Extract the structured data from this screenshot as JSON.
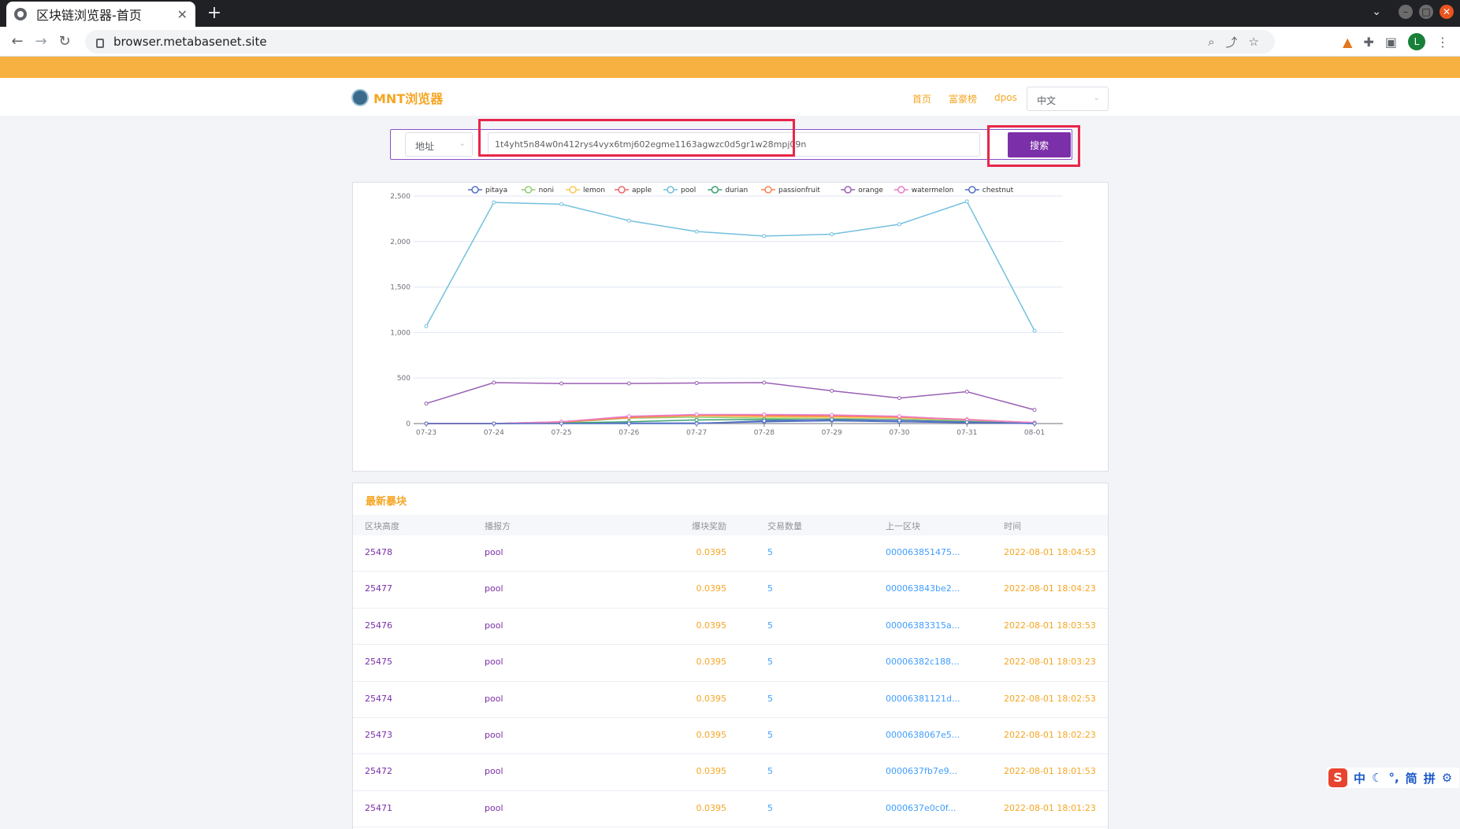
{
  "browser": {
    "tab_title": "区块链浏览器-首页",
    "tab_close": "✕",
    "new_tab": "+",
    "url": "browser.metabasenet.site",
    "avatar_letter": "L"
  },
  "site": {
    "logo_text": "MNT浏览器",
    "nav": [
      "首页",
      "富豪榜",
      "dpos"
    ],
    "lang": "中文"
  },
  "search": {
    "type_label": "地址",
    "input_value": "1t4yht5n84w0n412rys4vyx6tmj602egme1163agwzc0d5gr1w28mpj09n",
    "button_label": "搜索"
  },
  "chart_data": {
    "type": "line",
    "categories": [
      "07-23",
      "07-24",
      "07-25",
      "07-26",
      "07-27",
      "07-28",
      "07-29",
      "07-30",
      "07-31",
      "08-01"
    ],
    "ylim": [
      0,
      2500
    ],
    "yticks": [
      "0",
      "500",
      "1,000",
      "1,500",
      "2,000",
      "2,500"
    ],
    "ytick_values": [
      0,
      500,
      1000,
      1500,
      2000,
      2500
    ],
    "legend_position": "top-center",
    "grid": true,
    "series": [
      {
        "name": "pitaya",
        "color": "#5470c6",
        "values": [
          0,
          0,
          5,
          5,
          5,
          20,
          30,
          20,
          10,
          0
        ]
      },
      {
        "name": "noni",
        "color": "#91cc75",
        "values": [
          0,
          0,
          10,
          60,
          70,
          60,
          55,
          50,
          30,
          5
        ]
      },
      {
        "name": "lemon",
        "color": "#fac858",
        "values": [
          0,
          0,
          15,
          70,
          85,
          75,
          70,
          65,
          40,
          5
        ]
      },
      {
        "name": "apple",
        "color": "#ee6666",
        "values": [
          0,
          0,
          20,
          75,
          95,
          90,
          85,
          75,
          45,
          10
        ]
      },
      {
        "name": "pool",
        "color": "#73c0de",
        "values": [
          1070,
          2430,
          2410,
          2230,
          2110,
          2060,
          2080,
          2190,
          2440,
          1020
        ]
      },
      {
        "name": "durian",
        "color": "#3ba272",
        "values": [
          0,
          0,
          5,
          20,
          40,
          45,
          40,
          35,
          20,
          5
        ]
      },
      {
        "name": "passionfruit",
        "color": "#fc8452",
        "values": [
          0,
          0,
          15,
          65,
          90,
          85,
          80,
          70,
          40,
          10
        ]
      },
      {
        "name": "orange",
        "color": "#9a60b4",
        "values": [
          220,
          450,
          440,
          440,
          445,
          450,
          360,
          280,
          350,
          150
        ]
      },
      {
        "name": "watermelon",
        "color": "#ea7ccc",
        "values": [
          0,
          0,
          20,
          80,
          100,
          100,
          95,
          80,
          40,
          10
        ]
      },
      {
        "name": "chestnut",
        "color": "#5470c6",
        "values": [
          0,
          0,
          0,
          0,
          0,
          30,
          45,
          35,
          15,
          0
        ]
      }
    ]
  },
  "table": {
    "title": "最新暴块",
    "headers": [
      "区块高度",
      "播报方",
      "爆块奖励",
      "交易数量",
      "上一区块",
      "时间"
    ],
    "rows": [
      [
        "25478",
        "pool",
        "0.0395",
        "5",
        "000063851475...",
        "2022-08-01 18:04:53"
      ],
      [
        "25477",
        "pool",
        "0.0395",
        "5",
        "000063843be2...",
        "2022-08-01 18:04:23"
      ],
      [
        "25476",
        "pool",
        "0.0395",
        "5",
        "00006383315a...",
        "2022-08-01 18:03:53"
      ],
      [
        "25475",
        "pool",
        "0.0395",
        "5",
        "00006382c188...",
        "2022-08-01 18:03:23"
      ],
      [
        "25474",
        "pool",
        "0.0395",
        "5",
        "00006381121d...",
        "2022-08-01 18:02:53"
      ],
      [
        "25473",
        "pool",
        "0.0395",
        "5",
        "0000638067e5...",
        "2022-08-01 18:02:23"
      ],
      [
        "25472",
        "pool",
        "0.0395",
        "5",
        "0000637fb7e9...",
        "2022-08-01 18:01:53"
      ],
      [
        "25471",
        "pool",
        "0.0395",
        "5",
        "0000637e0c0f...",
        "2022-08-01 18:01:23"
      ]
    ]
  },
  "ime": {
    "logo": "S",
    "items": [
      "中",
      "☾",
      "°,",
      "简",
      "拼",
      "⚙"
    ]
  }
}
